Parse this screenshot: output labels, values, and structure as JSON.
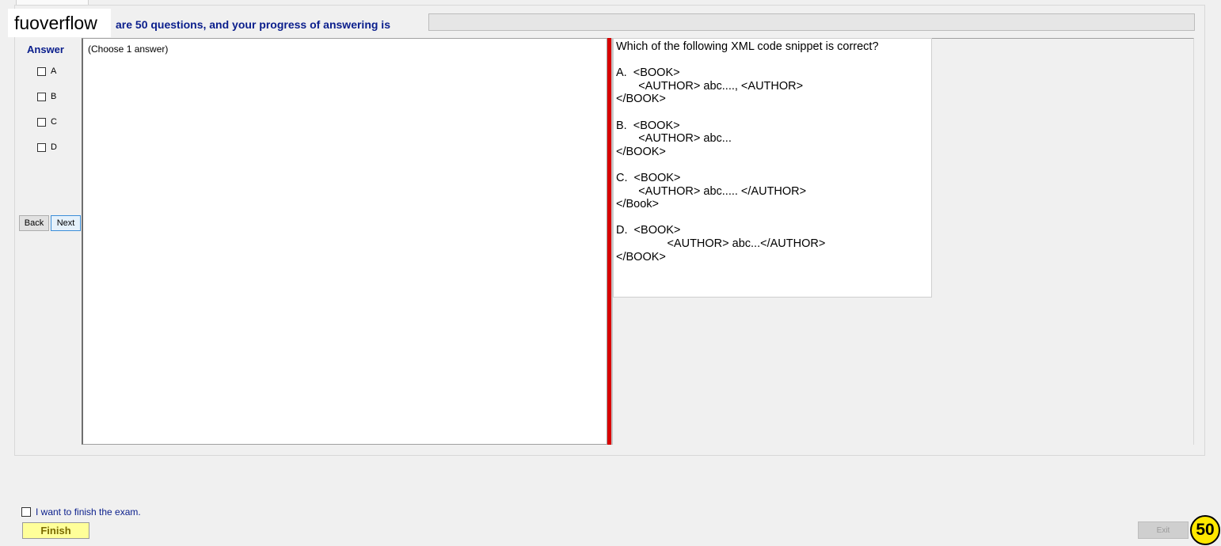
{
  "watermark": "fuoverflow",
  "header": {
    "progress_text": "are 50 questions, and your progress of answering is",
    "progress_fraction": 0
  },
  "answer": {
    "heading": "Answer",
    "choose_label": "(Choose 1 answer)",
    "options": [
      {
        "label": "A",
        "checked": false
      },
      {
        "label": "B",
        "checked": false
      },
      {
        "label": "C",
        "checked": false
      },
      {
        "label": "D",
        "checked": false
      }
    ]
  },
  "nav": {
    "back_label": "Back",
    "next_label": "Next"
  },
  "question": {
    "text": "Which of the following XML code snippet is correct?\n\nA.  <BOOK>\n       <AUTHOR> abc...., <AUTHOR>\n</BOOK>\n\nB.  <BOOK>\n       <AUTHOR> abc...\n</BOOK>\n\nC.  <BOOK>\n       <AUTHOR> abc..... </AUTHOR>\n</Book>\n\nD.  <BOOK>\n                <AUTHOR> abc...</AUTHOR>\n</BOOK>"
  },
  "footer": {
    "finish_check_label": "I want to finish the exam.",
    "finish_label": "Finish",
    "exit_label": "Exit",
    "question_count": "50"
  },
  "colors": {
    "accent": "#0a1e8c",
    "splitter": "#d90000",
    "finish_bg": "#ffff99",
    "badge": "#ffe800"
  }
}
